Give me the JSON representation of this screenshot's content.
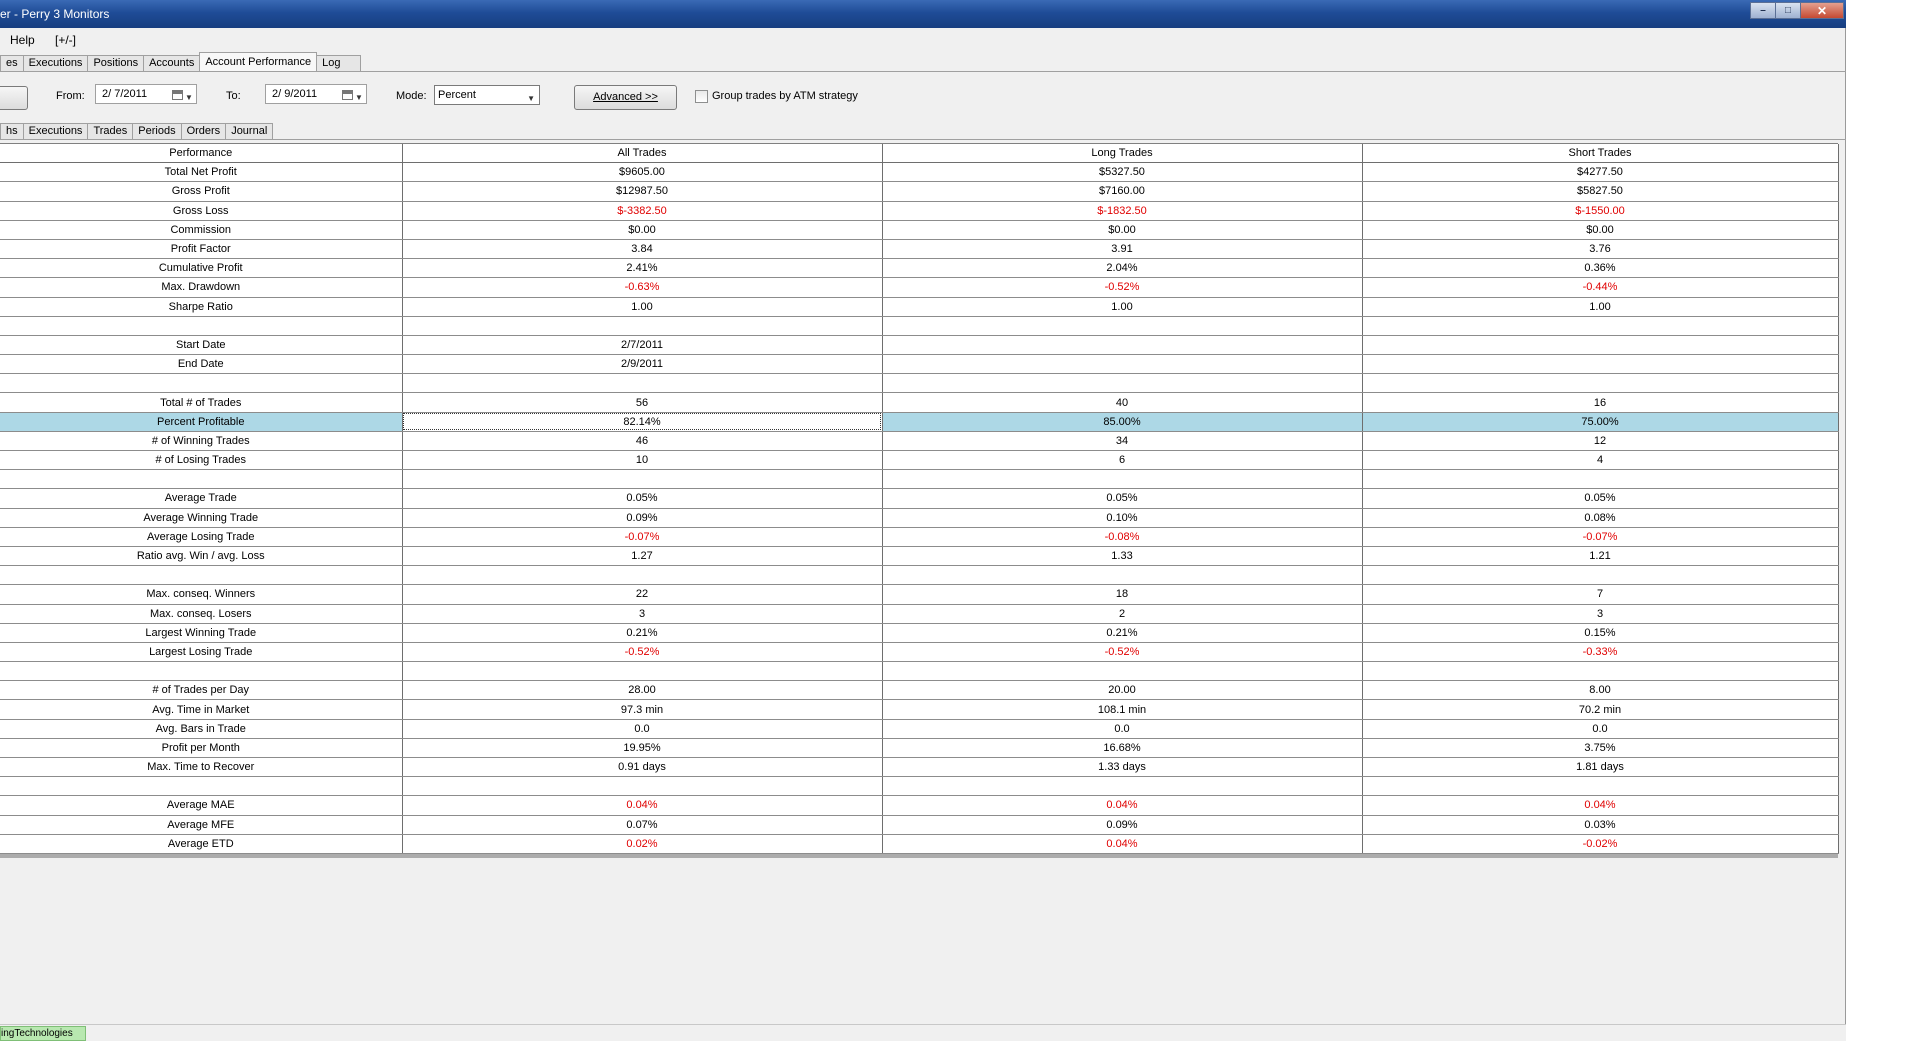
{
  "window": {
    "title": "er - Perry 3 Monitors",
    "controls": {
      "minimize": "–",
      "maximize": "□",
      "close": "✕"
    }
  },
  "menu": {
    "help": "Help",
    "toggle": "[+/-]"
  },
  "top_tabs": [
    "es",
    "Executions",
    "Positions",
    "Accounts",
    "Account Performance",
    "Log"
  ],
  "toolbar": {
    "from_label": "From:",
    "from_value": "2/ 7/2011",
    "to_label": "To:",
    "to_value": "2/ 9/2011",
    "mode_label": "Mode:",
    "mode_value": "Percent",
    "advanced_label": "Advanced >>",
    "group_label": "Group trades by ATM strategy"
  },
  "sub_tabs": [
    "hs",
    "Executions",
    "Trades",
    "Periods",
    "Orders",
    "Journal"
  ],
  "table": {
    "headers": [
      "Performance",
      "All Trades",
      "Long Trades",
      "Short Trades"
    ],
    "rows": [
      [
        "Total Net Profit",
        "$9605.00",
        "$5327.50",
        "$4277.50"
      ],
      [
        "Gross Profit",
        "$12987.50",
        "$7160.00",
        "$5827.50"
      ],
      [
        "Gross Loss",
        "$-3382.50",
        "$-1832.50",
        "$-1550.00"
      ],
      [
        "Commission",
        "$0.00",
        "$0.00",
        "$0.00"
      ],
      [
        "Profit Factor",
        "3.84",
        "3.91",
        "3.76"
      ],
      [
        "Cumulative Profit",
        "2.41%",
        "2.04%",
        "0.36%"
      ],
      [
        "Max. Drawdown",
        "-0.63%",
        "-0.52%",
        "-0.44%"
      ],
      [
        "Sharpe Ratio",
        "1.00",
        "1.00",
        "1.00"
      ],
      [
        "",
        "",
        "",
        ""
      ],
      [
        "Start Date",
        "2/7/2011",
        "",
        ""
      ],
      [
        "End Date",
        "2/9/2011",
        "",
        ""
      ],
      [
        "",
        "",
        "",
        ""
      ],
      [
        "Total # of Trades",
        "56",
        "40",
        "16"
      ],
      [
        "Percent Profitable",
        "82.14%",
        "85.00%",
        "75.00%"
      ],
      [
        "# of Winning Trades",
        "46",
        "34",
        "12"
      ],
      [
        "# of Losing Trades",
        "10",
        "6",
        "4"
      ],
      [
        "",
        "",
        "",
        ""
      ],
      [
        "Average Trade",
        "0.05%",
        "0.05%",
        "0.05%"
      ],
      [
        "Average Winning Trade",
        "0.09%",
        "0.10%",
        "0.08%"
      ],
      [
        "Average Losing Trade",
        "-0.07%",
        "-0.08%",
        "-0.07%"
      ],
      [
        "Ratio avg. Win / avg. Loss",
        "1.27",
        "1.33",
        "1.21"
      ],
      [
        "",
        "",
        "",
        ""
      ],
      [
        "Max. conseq. Winners",
        "22",
        "18",
        "7"
      ],
      [
        "Max. conseq. Losers",
        "3",
        "2",
        "3"
      ],
      [
        "Largest Winning Trade",
        "0.21%",
        "0.21%",
        "0.15%"
      ],
      [
        "Largest Losing Trade",
        "-0.52%",
        "-0.52%",
        "-0.33%"
      ],
      [
        "",
        "",
        "",
        ""
      ],
      [
        "# of Trades per Day",
        "28.00",
        "20.00",
        "8.00"
      ],
      [
        "Avg. Time in Market",
        "97.3 min",
        "108.1 min",
        "70.2 min"
      ],
      [
        "Avg. Bars in Trade",
        "0.0",
        "0.0",
        "0.0"
      ],
      [
        "Profit per Month",
        "19.95%",
        "16.68%",
        "3.75%"
      ],
      [
        "Max. Time to Recover",
        "0.91 days",
        "1.33 days",
        "1.81 days"
      ],
      [
        "",
        "",
        "",
        ""
      ],
      [
        "Average MAE",
        "0.04%",
        "0.04%",
        "0.04%"
      ],
      [
        "Average MFE",
        "0.07%",
        "0.09%",
        "0.03%"
      ],
      [
        "Average ETD",
        "0.02%",
        "0.04%",
        "-0.02%"
      ]
    ],
    "red_rows": [
      2,
      6,
      19,
      25,
      33,
      35
    ],
    "selected_row": 13,
    "selection_color": "#add8e6",
    "negative_color": "#e00000"
  },
  "status": {
    "connection": "ingTechnologies"
  }
}
